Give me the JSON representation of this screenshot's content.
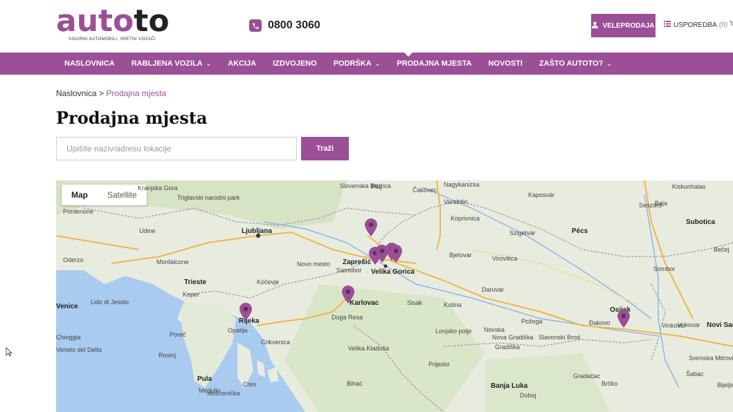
{
  "brand": {
    "logo_part1": "auto",
    "logo_part2": "to",
    "tagline": "SIGURNI AUTOMOBILI, SRETNI VOZAČI",
    "accent_color": "#9b4f96"
  },
  "header": {
    "phone": "0800 3060",
    "veleprodaja": "VELEPRODAJA",
    "usporedba": "USPOREDBA",
    "usporedba_count": "(0)"
  },
  "nav": {
    "items": [
      {
        "label": "NASLOVNICA",
        "dropdown": false
      },
      {
        "label": "RABLJENA VOZILA",
        "dropdown": true
      },
      {
        "label": "AKCIJA",
        "dropdown": false
      },
      {
        "label": "IZDVOJENO",
        "dropdown": false
      },
      {
        "label": "PODRŠKA",
        "dropdown": true
      },
      {
        "label": "PRODAJNA MJESTA",
        "dropdown": false
      },
      {
        "label": "NOVOSTI",
        "dropdown": false
      },
      {
        "label": "ZAŠTO AUTOTO?",
        "dropdown": true
      }
    ]
  },
  "breadcrumb": {
    "home": "Naslovnica",
    "separator": ">",
    "current": "Prodajna mjesta"
  },
  "page": {
    "title": "Prodajna mjesta"
  },
  "search": {
    "placeholder": "Upišite naziv/adresu lokacije",
    "value": "",
    "button": "Traži"
  },
  "map": {
    "type_map": "Map",
    "type_satellite": "Satellite",
    "labels": [
      "Kranjska Gora",
      "Triglavski narodni park",
      "Udine",
      "Ljubljana",
      "Slovenska Bistrica",
      "Ptuj",
      "Čakovec",
      "Nagykanizsa",
      "Kaposvár",
      "Kiskunhalas",
      "Monfalcone",
      "Trieste",
      "Koper",
      "Venice",
      "Lido di Jesolo",
      "Novo mesto",
      "Kočevje",
      "Zaprešić",
      "Samobor",
      "Velika Gorica",
      "Varaždin",
      "Koprivnica",
      "Bjelovar",
      "Virovitica",
      "Szigetvár",
      "Pécs",
      "Baja",
      "Subotica",
      "Karlovac",
      "Duga Resa",
      "Rijeka",
      "Opatija",
      "Crikvenica",
      "Sisak",
      "Kutina",
      "Daruvar",
      "Osijek",
      "Sombor",
      "Vukovar",
      "Vinkovci",
      "Đakovo",
      "Požega",
      "Novska",
      "Nova Gradiška",
      "Slavonski Brod",
      "Lonjsko polje",
      "Gradiška",
      "Velika Kladuša",
      "Bihać",
      "Prijedor",
      "Banja Luka",
      "Poreč",
      "Rovinj",
      "Pula",
      "Cres",
      "Veneto del Delta",
      "Chioggia",
      "Novi Sad",
      "Sremska Mitrovica",
      "Šabac",
      "Gradačac",
      "Brčko",
      "Doboj",
      "Bijeljina",
      "Pordenone",
      "Oderzo",
      "Mošćenička",
      "Medulin",
      "Seszárd",
      "Bečej"
    ],
    "pins": [
      {
        "name": "Varaždin area"
      },
      {
        "name": "Zagreb 1"
      },
      {
        "name": "Zagreb 2"
      },
      {
        "name": "Zagreb 3"
      },
      {
        "name": "Zagreb 4"
      },
      {
        "name": "Karlovac"
      },
      {
        "name": "Rijeka"
      },
      {
        "name": "Vinkovci"
      }
    ]
  }
}
